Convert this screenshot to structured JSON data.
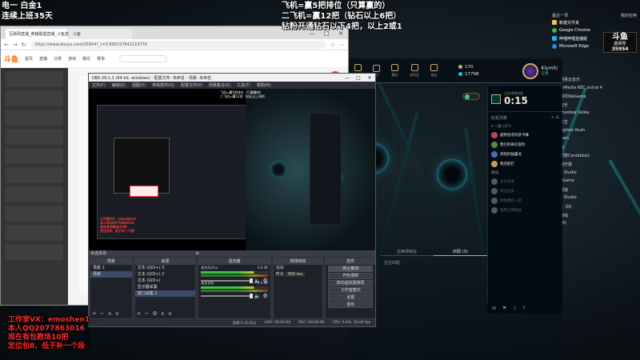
{
  "overlay": {
    "top_left": [
      "电一 白金1",
      "连续上班35天"
    ],
    "top_middle": [
      "飞机=赢5把排位（只算赢的）",
      "二飞机=赢12把（钻石以上6把）",
      "钻粉开通钻石以下4把，以上2或1"
    ],
    "bottom_left": [
      "工作室VX：emoshen1",
      "本人QQ2077863016",
      "现在有包教场10把",
      "定位包8，低于补一个段"
    ]
  },
  "desktop": {
    "header_left": "最近一项",
    "header_right": "我的应用",
    "items": [
      {
        "label": "新建文件夹",
        "icon": "folder-icon",
        "color": "#e8c45a"
      },
      {
        "label": "Google Chrome",
        "icon": "chrome-icon",
        "color": "#4caf50"
      },
      {
        "label": "哔哩哔哩直播姬",
        "icon": "app-icon",
        "color": "#23ade5"
      },
      {
        "label": "Microsoft Edge",
        "icon": "edge-icon",
        "color": "#1e88e5"
      }
    ],
    "logo_text": "斗鱼",
    "logo_sub": "房间号",
    "logo_num": "35954",
    "side_list": [
      "网易云音乐",
      "erMedia REC entral 4",
      "腾讯WeGame",
      "音乐",
      "Stardew Valley",
      "长生",
      "ngdom Rush",
      "eam",
      "阿",
      "刷表Cantabile2",
      "我开窗",
      "S Studio",
      "eGame",
      "频道",
      "S Studio",
      "Ｉ QQ",
      "游戏",
      "QQ"
    ]
  },
  "browser": {
    "tabs": [
      "互联网直播_英雄联盟直播_斗鱼直播",
      "斗鱼"
    ],
    "window_controls": [
      "—",
      "□",
      "✕"
    ],
    "url": "https://www.douyu.com/35954?_t=0.895537842219776",
    "logo": "斗鱼",
    "nav": [
      "首页",
      "直播",
      "分类",
      "游戏",
      "娱乐",
      "赛事"
    ]
  },
  "obs": {
    "title": "OBS 26.1.1 (64 bit, windows) - 配置文件: 未命名 - 场景: 未命名",
    "window_controls": [
      "—",
      "□",
      "✕"
    ],
    "menu": [
      "文件(F)",
      "编辑(E)",
      "视图(V)",
      "停靠部件(D)",
      "配置文件(P)",
      "场景集合(S)",
      "工具(T)",
      "帮助(H)"
    ],
    "nested_title": [
      "飞机=赢5把排位（只算赢的）",
      "二飞机=赢12把（钻石以上6把）"
    ],
    "nested_red": [
      "工作室VX：emoshen1",
      "本人QQ2077863016",
      "现在有包教场10把",
      "定位包8，低于补一个段"
    ],
    "source_label": "未选择源",
    "docks": {
      "scenes": {
        "title": "场景",
        "items": [
          "场景 2",
          "场景"
        ]
      },
      "sources": {
        "title": "来源",
        "items": [
          "文本 (GDI+) 3",
          "文本 (GDI+) 2",
          "文本 (GDI+)",
          "显示器采集",
          "窗口采集 2"
        ]
      },
      "mixer": {
        "title": "混音器",
        "channels": [
          {
            "name": "麦克风/Aux",
            "db": "0.0 dB"
          },
          {
            "name": "桌面音频",
            "db": "0.0 dB"
          }
        ]
      },
      "transitions": {
        "title": "转场特效",
        "mode": "淡出",
        "duration_label": "时长",
        "duration": "300 ms"
      },
      "controls": {
        "title": "控件",
        "buttons": [
          "停止推流",
          "开始录制",
          "启动虚拟摄像机",
          "工作室模式",
          "设置",
          "退出"
        ]
      }
    },
    "status": [
      "丢帧 0 (0.0%)",
      "LIVE: 00:00:00",
      "REC: 00:00:00",
      "CPU: 0.4%, 30.00 fps"
    ]
  },
  "client": {
    "nav": [
      "主页",
      "TFT",
      "藏品",
      "战利品",
      "商店"
    ],
    "rp": "170",
    "be": "17798",
    "player_name": "Klymhi",
    "player_status": "在线",
    "timer_label": "正在寻找对局",
    "timer_value": "0:15",
    "friends_title": "好友列表",
    "group_label": "▾ 一般 (3/7)",
    "friends": [
      {
        "name": "越界思考的新卡蜂",
        "online": true,
        "color": "#b84a4a"
      },
      {
        "name": "我们的奇幻冒险",
        "online": true,
        "color": "#5b8a3c"
      },
      {
        "name": "黑暗的独霸龙",
        "online": true,
        "color": "#4a6cb8"
      },
      {
        "name": "我还能打",
        "online": true,
        "color": "#c8a04a"
      },
      {
        "name": "天山流浪",
        "online": false,
        "color": "#556"
      },
      {
        "name": "开之过去",
        "online": false,
        "color": "#556"
      },
      {
        "name": "你和我在一起",
        "online": false,
        "color": "#556"
      },
      {
        "name": "暗月之所向往",
        "online": false,
        "color": "#556"
      }
    ],
    "offline_label": "离线",
    "queue_tabs": [
      "召唤师峡谷",
      "匹配 (0)"
    ],
    "matching": "正在匹配"
  },
  "colors": {
    "overlay_red": "#ff2a2a",
    "lol_gold": "#c8aa6e",
    "lol_cyan": "#0acbe6"
  }
}
